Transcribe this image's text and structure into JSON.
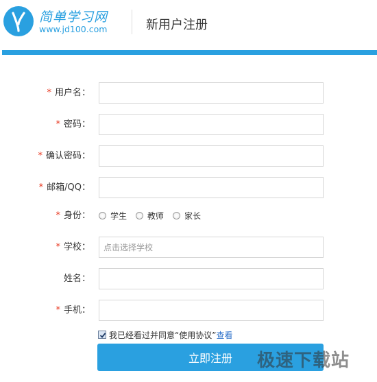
{
  "header": {
    "logo_text_cn": "简单学习网",
    "logo_url": "www.jd100.com",
    "title": "新用户注册"
  },
  "form": {
    "required_mark": "*",
    "fields": [
      {
        "label": "用户名：",
        "required": true,
        "value": "",
        "placeholder": ""
      },
      {
        "label": "密码：",
        "required": true,
        "value": "",
        "placeholder": ""
      },
      {
        "label": "确认密码：",
        "required": true,
        "value": "",
        "placeholder": ""
      },
      {
        "label": "邮箱/QQ：",
        "required": true,
        "value": "",
        "placeholder": ""
      }
    ],
    "identity": {
      "label": "身份：",
      "options": [
        "学生",
        "教师",
        "家长"
      ]
    },
    "school": {
      "label": "学校：",
      "placeholder": "点击选择学校"
    },
    "name": {
      "label": "姓名：",
      "value": ""
    },
    "phone": {
      "label": "手机：",
      "value": ""
    },
    "agreement": {
      "text": "我已经看过并同意“使用协议”",
      "link": "查看",
      "checked": true
    },
    "submit_label": "立即注册"
  },
  "watermark": "极速下载站",
  "colors": {
    "accent": "#2aa0e0",
    "required": "#e8341c",
    "link": "#2a6fc9"
  }
}
